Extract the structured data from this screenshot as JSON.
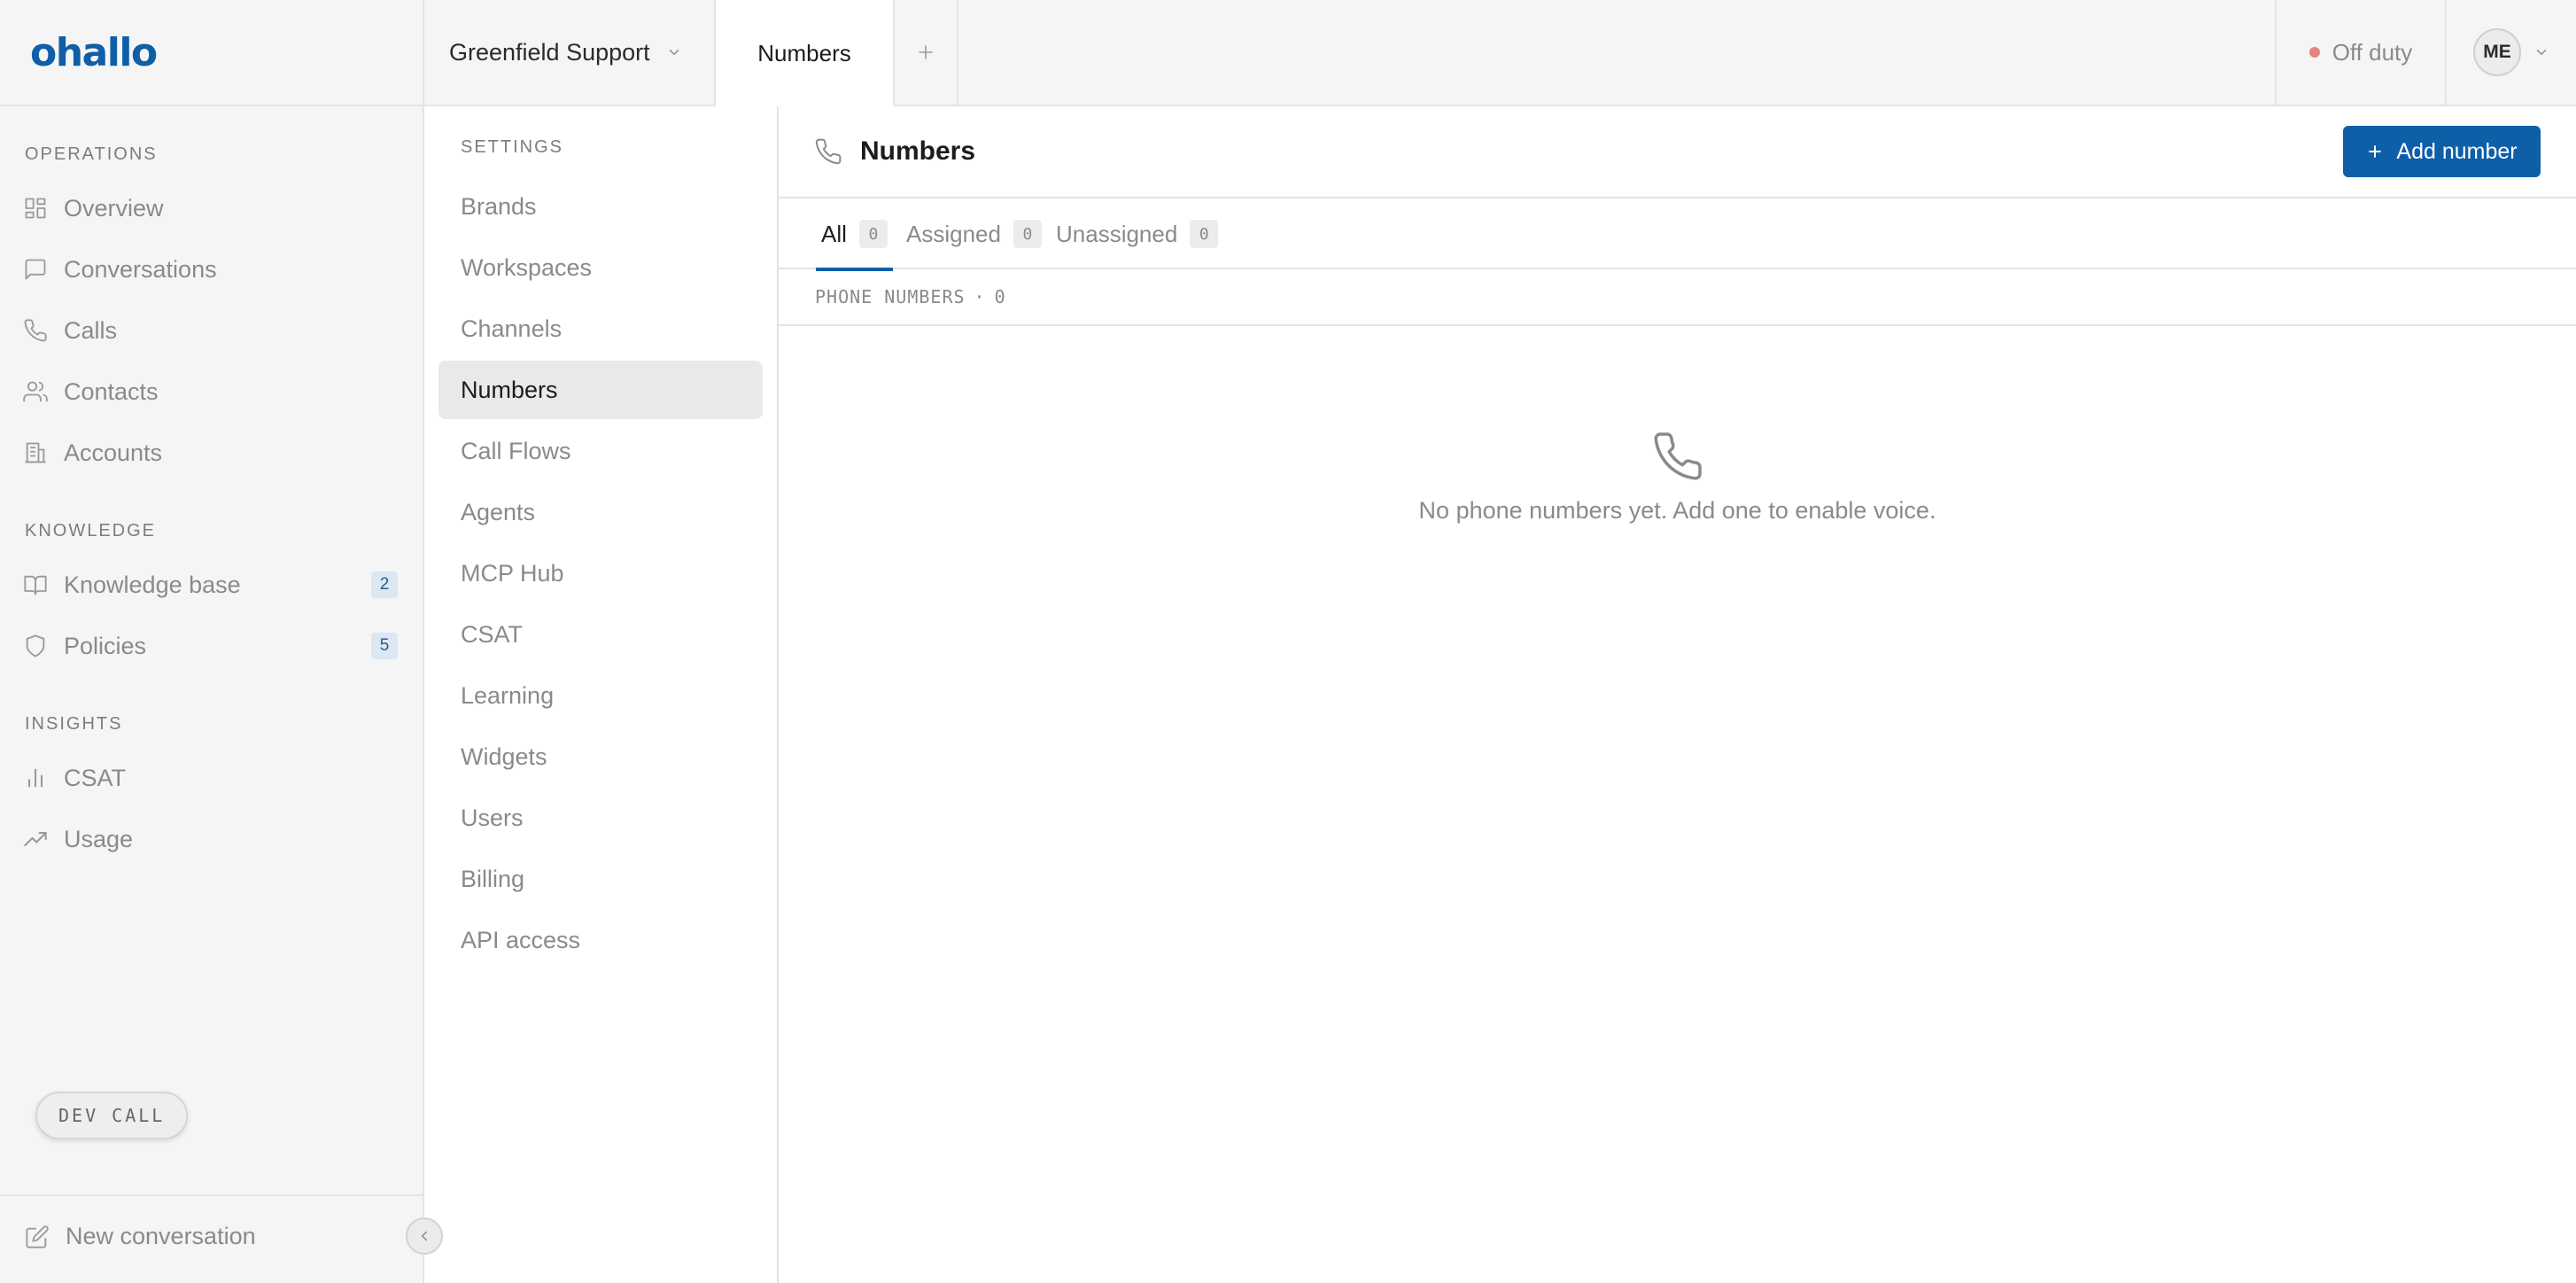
{
  "app": {
    "logo": "ohallo",
    "workspace": "Greenfield Support",
    "active_tab": "Numbers",
    "status": "Off duty",
    "user_initials": "ME"
  },
  "sidebar": {
    "sections": [
      {
        "label": "OPERATIONS",
        "items": [
          {
            "label": "Overview",
            "icon": "grid-icon"
          },
          {
            "label": "Conversations",
            "icon": "chat-icon"
          },
          {
            "label": "Calls",
            "icon": "phone-icon"
          },
          {
            "label": "Contacts",
            "icon": "users-icon"
          },
          {
            "label": "Accounts",
            "icon": "building-icon"
          }
        ]
      },
      {
        "label": "KNOWLEDGE",
        "items": [
          {
            "label": "Knowledge base",
            "icon": "book-icon",
            "badge": "2"
          },
          {
            "label": "Policies",
            "icon": "shield-icon",
            "badge": "5"
          }
        ]
      },
      {
        "label": "INSIGHTS",
        "items": [
          {
            "label": "CSAT",
            "icon": "bar-chart-icon"
          },
          {
            "label": "Usage",
            "icon": "trending-up-icon"
          }
        ]
      }
    ],
    "footer_item": "New conversation",
    "dev_badge": "DEV CALL"
  },
  "settings": {
    "label": "SETTINGS",
    "items": [
      "Brands",
      "Workspaces",
      "Channels",
      "Numbers",
      "Call Flows",
      "Agents",
      "MCP Hub",
      "CSAT",
      "Learning",
      "Widgets",
      "Users",
      "Billing",
      "API access"
    ],
    "active": "Numbers"
  },
  "main": {
    "title": "Numbers",
    "add_button": "Add number",
    "tabs": [
      {
        "label": "All",
        "count": "0"
      },
      {
        "label": "Assigned",
        "count": "0"
      },
      {
        "label": "Unassigned",
        "count": "0"
      }
    ],
    "list_header": "PHONE NUMBERS",
    "list_separator": "·",
    "list_count": "0",
    "empty_text": "No phone numbers yet. Add one to enable voice."
  },
  "colors": {
    "brand": "#0f5ea8",
    "status_off_duty": "#e8837b",
    "badge_bg": "#dbe7f3"
  }
}
